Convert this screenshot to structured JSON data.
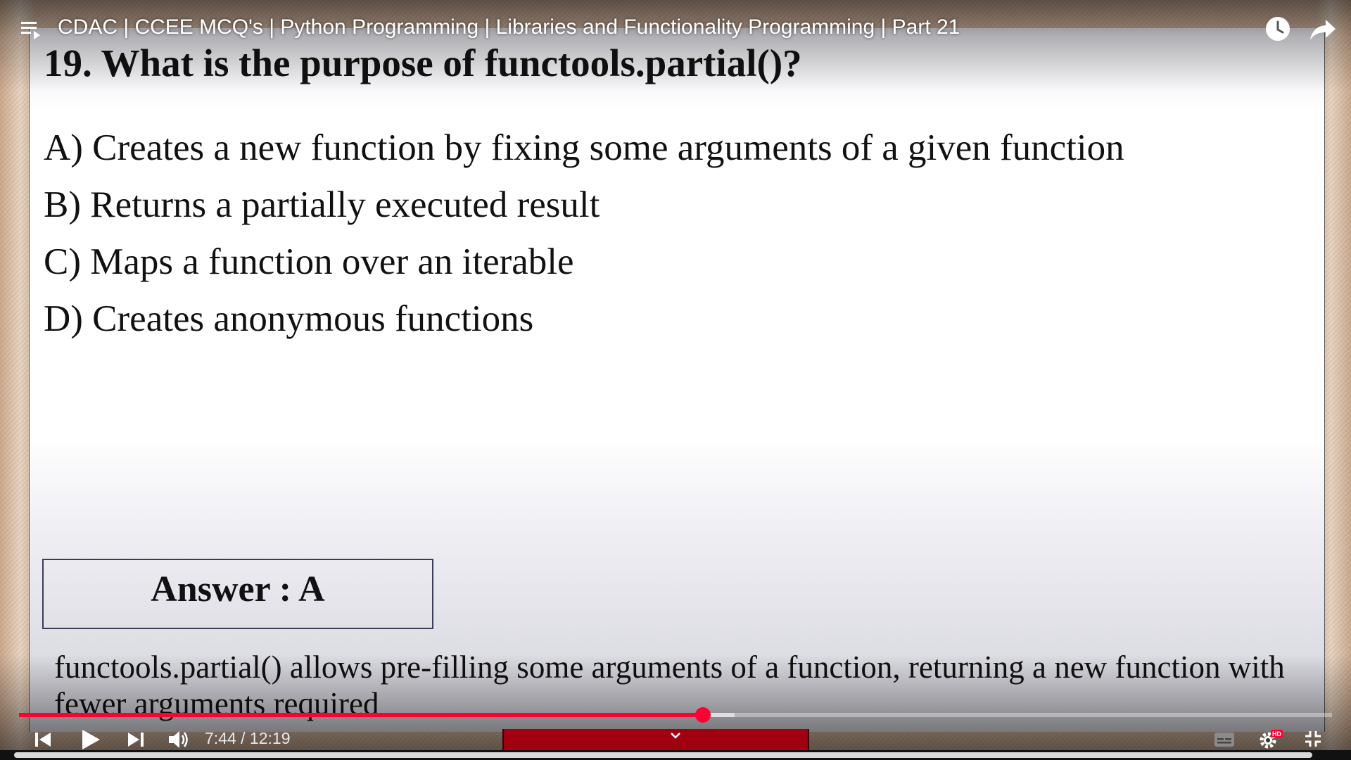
{
  "player": {
    "title": "CDAC | CCEE MCQ's | Python Programming | Libraries and Functionality Programming | Part 21",
    "time_current": "7:44",
    "time_total": "12:19",
    "time_display": "7:44 / 12:19",
    "played_fraction": 0.5209,
    "buffered_fraction": 0.5451,
    "hd_badge": "HD",
    "accent_color": "#ff0033"
  },
  "slide": {
    "question": "19. What is the purpose of  functools.partial()?",
    "options": [
      "A) Creates a new function by fixing some arguments of  a given function",
      "B) Returns a partially executed result",
      "C) Maps a function over an iterable",
      "D) Creates anonymous functions"
    ],
    "answer": "Answer : A",
    "explanation": "functools.partial() allows pre-filling some arguments of  a function, returning a new function with fewer arguments required"
  },
  "icons": [
    "playlist-icon",
    "watch-later-icon",
    "share-icon",
    "previous-icon",
    "play-icon",
    "next-icon",
    "volume-icon",
    "chevron-down-icon",
    "subtitles-icon",
    "settings-icon",
    "exit-fullscreen-icon"
  ]
}
